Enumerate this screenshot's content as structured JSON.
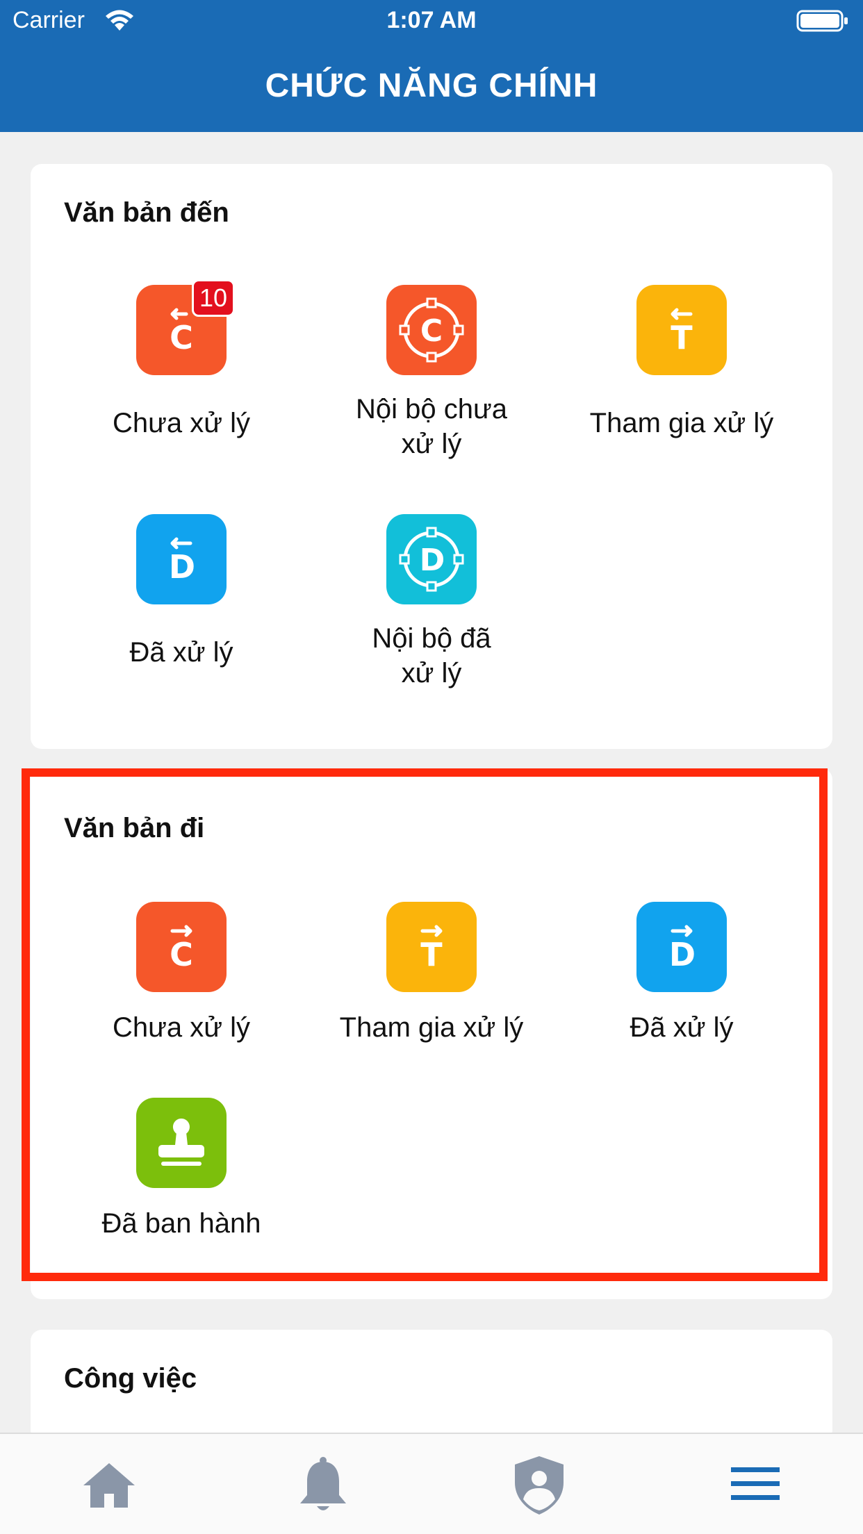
{
  "status_bar": {
    "carrier": "Carrier",
    "time": "1:07 AM"
  },
  "header": {
    "title": "CHỨC NĂNG CHÍNH"
  },
  "incoming": {
    "title": "Văn bản đến",
    "items": [
      {
        "label": "Chưa xử lý",
        "icon": "incoming-c-icon",
        "color": "#f5572a",
        "badge": "10"
      },
      {
        "label": "Nội bộ chưa xử lý",
        "icon": "internal-c-icon",
        "color": "#f5572a"
      },
      {
        "label": "Tham gia xử lý",
        "icon": "incoming-t-icon",
        "color": "#fbb40b"
      },
      {
        "label": "Đã xử lý",
        "icon": "incoming-d-icon",
        "color": "#11a3ee"
      },
      {
        "label": "Nội bộ đã xử lý",
        "icon": "internal-d-icon",
        "color": "#12bfd9"
      }
    ]
  },
  "outgoing": {
    "title": "Văn bản đi",
    "items": [
      {
        "label": "Chưa xử lý",
        "icon": "outgoing-c-icon",
        "color": "#f5572a"
      },
      {
        "label": "Tham gia xử lý",
        "icon": "outgoing-t-icon",
        "color": "#fbb40b"
      },
      {
        "label": "Đã xử lý",
        "icon": "outgoing-d-icon",
        "color": "#11a3ee"
      },
      {
        "label": "Đã ban hành",
        "icon": "stamp-icon",
        "color": "#7cbf0c"
      }
    ]
  },
  "tasks": {
    "title": "Công việc"
  },
  "tabbar": {
    "items": [
      {
        "icon": "home-icon",
        "color": "#8a96a8"
      },
      {
        "icon": "bell-icon",
        "color": "#8a96a8"
      },
      {
        "icon": "shield-user-icon",
        "color": "#8a96a8"
      },
      {
        "icon": "menu-icon",
        "color": "#1a6bb5"
      }
    ]
  },
  "colors": {
    "header": "#1a6bb5",
    "highlight": "#ff2a0c"
  }
}
